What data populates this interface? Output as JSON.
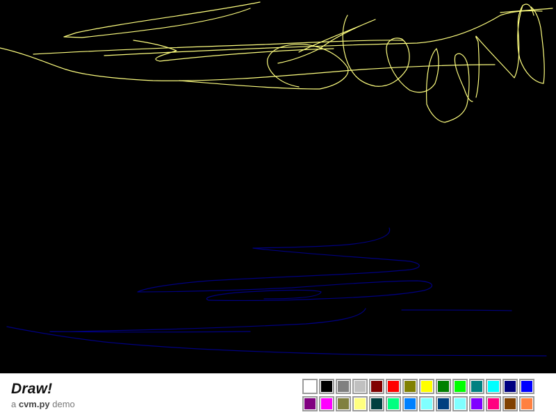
{
  "app": {
    "title": "Draw!",
    "subtitle_prefix": "a ",
    "subtitle_emphasis": "cvm.py",
    "subtitle_suffix": " demo"
  },
  "canvas": {
    "background": "#000000"
  },
  "palette": {
    "colors": [
      "#ffffff",
      "#000000",
      "#808080",
      "#c0c0c0",
      "#800000",
      "#ff0000",
      "#808000",
      "#ffff00",
      "#008000",
      "#00ff00",
      "#008080",
      "#00ffff",
      "#000080",
      "#0000ff",
      "#800080",
      "#ff00ff",
      "#808040",
      "#ffff80",
      "#004040",
      "#00ff80",
      "#0080ff",
      "#80ffff",
      "#004080",
      "#80ffff",
      "#8000ff",
      "#ff0080",
      "#804000",
      "#ff8040"
    ]
  },
  "strokes": [
    {
      "color": "#ffff80"
    },
    {
      "color": "#ffff80"
    },
    {
      "color": "#ffff80"
    },
    {
      "color": "#ffff80"
    },
    {
      "color": "#ffff80"
    },
    {
      "color": "#ffff80"
    },
    {
      "color": "#ffff80"
    },
    {
      "color": "#ffff80"
    },
    {
      "color": "#ffff80"
    },
    {
      "color": "#ffff80"
    },
    {
      "color": "#ffff80"
    },
    {
      "color": "#000080"
    },
    {
      "color": "#000080"
    },
    {
      "color": "#000080"
    },
    {
      "color": "#000080"
    },
    {
      "color": "#000080"
    }
  ]
}
